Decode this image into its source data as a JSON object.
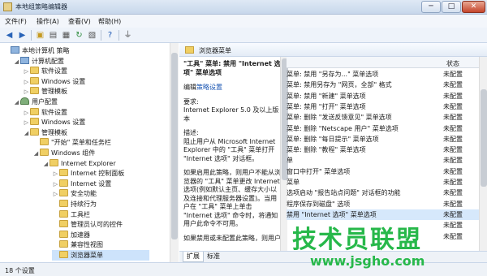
{
  "window": {
    "title": "本地组策略编辑器",
    "min": "─",
    "max": "□",
    "close": "✕"
  },
  "menu": [
    "文件(F)",
    "操作(A)",
    "查看(V)",
    "帮助(H)"
  ],
  "toolbar_icons": [
    "back-icon",
    "forward-icon",
    "up-folder-icon",
    "show-hide-tree-icon",
    "properties-icon",
    "refresh-icon",
    "export-icon",
    "help-icon",
    "filter-icon"
  ],
  "tree": [
    {
      "label": "本地计算机 策略",
      "icon": "computer",
      "indent": 0,
      "tw": ""
    },
    {
      "label": "计算机配置",
      "icon": "computer",
      "indent": 1,
      "tw": "◢"
    },
    {
      "label": "软件设置",
      "icon": "folder",
      "indent": 2,
      "tw": "▷"
    },
    {
      "label": "Windows 设置",
      "icon": "folder",
      "indent": 2,
      "tw": "▷"
    },
    {
      "label": "管理模板",
      "icon": "folder",
      "indent": 2,
      "tw": "▷"
    },
    {
      "label": "用户配置",
      "icon": "user",
      "indent": 1,
      "tw": "◢"
    },
    {
      "label": "软件设置",
      "icon": "folder",
      "indent": 2,
      "tw": "▷"
    },
    {
      "label": "Windows 设置",
      "icon": "folder",
      "indent": 2,
      "tw": "▷"
    },
    {
      "label": "管理模板",
      "icon": "folder",
      "indent": 2,
      "tw": "◢"
    },
    {
      "label": "\"开始\" 菜单和任务栏",
      "icon": "folder",
      "indent": 3,
      "tw": ""
    },
    {
      "label": "Windows 组件",
      "icon": "folder",
      "indent": 3,
      "tw": "◢"
    },
    {
      "label": "Internet Explorer",
      "icon": "folder",
      "indent": 4,
      "tw": "◢"
    },
    {
      "label": "Internet 控制面板",
      "icon": "folder",
      "indent": 5,
      "tw": "▷"
    },
    {
      "label": "Internet 设置",
      "icon": "folder",
      "indent": 5,
      "tw": "▷"
    },
    {
      "label": "安全功能",
      "icon": "folder",
      "indent": 5,
      "tw": "▷"
    },
    {
      "label": "持续行为",
      "icon": "folder",
      "indent": 5,
      "tw": ""
    },
    {
      "label": "工具栏",
      "icon": "folder",
      "indent": 5,
      "tw": ""
    },
    {
      "label": "管理员认可的控件",
      "icon": "folder",
      "indent": 5,
      "tw": ""
    },
    {
      "label": "加速器",
      "icon": "folder",
      "indent": 5,
      "tw": ""
    },
    {
      "label": "兼容性视图",
      "icon": "folder",
      "indent": 5,
      "tw": ""
    },
    {
      "label": "浏览器菜单",
      "icon": "folder",
      "indent": 5,
      "tw": "",
      "selected": true
    }
  ],
  "right": {
    "header": "浏览器菜单",
    "description": {
      "title": "\"工具\" 菜单: 禁用 \"Internet 选项\" 菜单选项",
      "edit_prefix": "编辑",
      "edit_link": "策略设置",
      "req_label": "要求:",
      "req_value": "Internet Explorer 5.0 及以上版本",
      "desc_label": "描述:",
      "desc_text": "阻止用户从 Microsoft Internet Explorer 中的 \"工具\" 菜单打开 \"Internet 选项\" 对话框。",
      "enable_text": "如果启用此策略，则用户不能从浏览器的 \"工具\" 菜单更改 Internet 选项(例如默认主页、缓存大小以及连接和代理服务器设置)。当用户在 \"工具\" 菜单上单击 \"Internet 选项\" 命令时，将通知用户此命令不可用。",
      "more_text": "如果禁用或未配置此策略，则用户"
    },
    "list_header_status": "状态",
    "rows": [
      {
        "name": "菜单: 禁用 \"另存为...\" 菜单选项",
        "status": "未配置"
      },
      {
        "name": "菜单: 禁用另存为 \"网页，全部\" 格式",
        "status": "未配置"
      },
      {
        "name": "菜单: 禁用 \"新建\" 菜单选项",
        "status": "未配置"
      },
      {
        "name": "菜单: 禁用 \"打开\" 菜单选项",
        "status": "未配置"
      },
      {
        "name": "菜单: 删除 \"发送反馈意见\" 菜单选项",
        "status": "未配置"
      },
      {
        "name": "菜单: 删除 \"Netscape 用户\" 菜单选项",
        "status": "未配置"
      },
      {
        "name": "菜单: 删除 \"每日提示\" 菜单选项",
        "status": "未配置"
      },
      {
        "name": "菜单: 删除 \"教程\" 菜单选项",
        "status": "未配置"
      },
      {
        "name": "单",
        "status": "未配置"
      },
      {
        "name": "窗口中打开\" 菜单选项",
        "status": "未配置"
      },
      {
        "name": "菜单",
        "status": "未配置"
      },
      {
        "name": "选项启动 \"报告站点问题\" 对话框的功能",
        "status": "未配置"
      },
      {
        "name": "程序保存到磁盘\" 选项",
        "status": "未配置"
      },
      {
        "name": "禁用 \"Internet 选项\" 菜单选项",
        "status": "未配置",
        "selected": true
      },
      {
        "name": "",
        "status": "未配置"
      },
      {
        "name": "",
        "status": "未配置"
      }
    ],
    "tabs": [
      "扩展",
      "标准"
    ]
  },
  "statusbar": "18 个设置",
  "watermark": {
    "brand": "技术员联盟",
    "url": "www.jsgho.com"
  }
}
